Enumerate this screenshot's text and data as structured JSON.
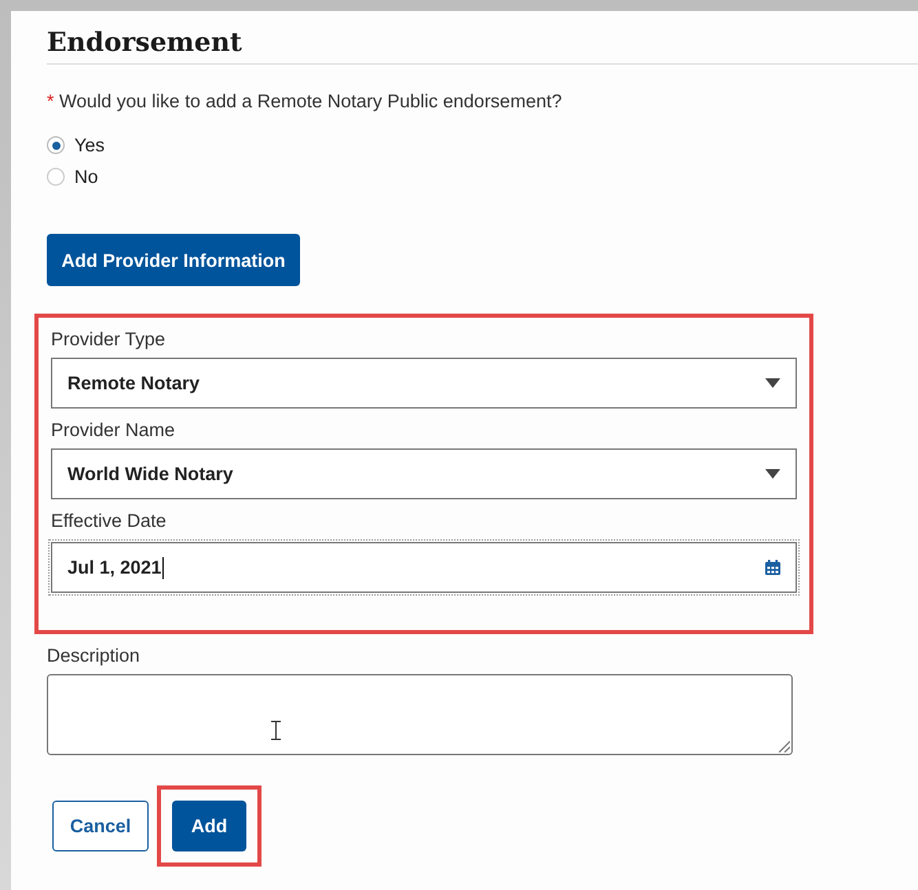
{
  "section": {
    "title": "Endorsement"
  },
  "question": {
    "required_mark": "*",
    "text": "Would you like to add a Remote Notary Public endorsement?"
  },
  "options": [
    {
      "label": "Yes",
      "selected": true
    },
    {
      "label": "No",
      "selected": false
    }
  ],
  "add_provider_button": "Add Provider Information",
  "fields": [
    {
      "kind": "select",
      "label": "Provider Type",
      "value": "Remote Notary"
    },
    {
      "kind": "select",
      "label": "Provider Name",
      "value": "World Wide Notary"
    },
    {
      "kind": "date",
      "label": "Effective Date",
      "value": "Jul 1, 2021"
    }
  ],
  "description": {
    "label": "Description"
  },
  "buttons": [
    {
      "kind": "secondary",
      "label": "Cancel"
    },
    {
      "kind": "primary",
      "label": "Add"
    }
  ]
}
